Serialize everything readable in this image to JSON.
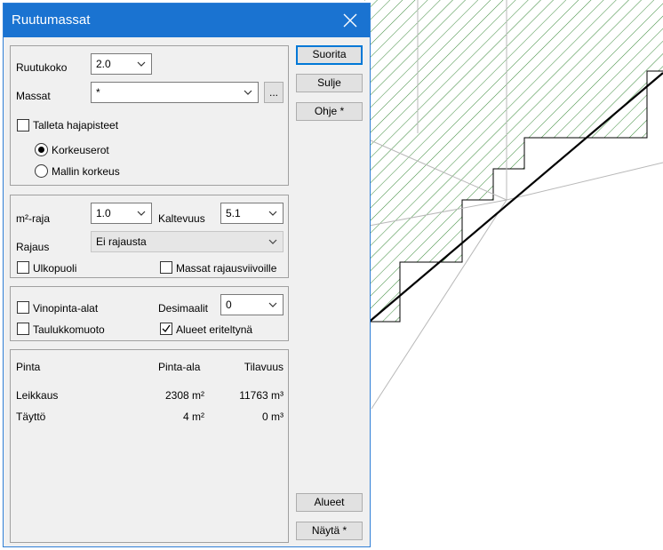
{
  "window": {
    "title": "Ruutumassat"
  },
  "settings": {
    "ruutukoko_label": "Ruutukoko",
    "ruutukoko_value": "2.0",
    "massat_label": "Massat",
    "massat_value": "*",
    "browse_label": "...",
    "talleta_label": "Talleta hajapisteet",
    "talleta_checked": false,
    "korkeuserot_label": "Korkeuserot",
    "korkeuserot_selected": true,
    "mallin_korkeus_label": "Mallin korkeus",
    "mallin_korkeus_selected": false
  },
  "limits": {
    "m2_raja_label": "m²-raja",
    "m2_raja_value": "1.0",
    "kaltevuus_label": "Kaltevuus",
    "kaltevuus_value": "5.1",
    "rajaus_label": "Rajaus",
    "rajaus_value": "Ei rajausta",
    "ulkopuoli_label": "Ulkopuoli",
    "ulkopuoli_checked": false,
    "massat_rajaus_label": "Massat rajausviivoille",
    "massat_rajaus_checked": false
  },
  "output": {
    "vinopinta_label": "Vinopinta-alat",
    "vinopinta_checked": false,
    "taulukko_label": "Taulukkomuoto",
    "taulukko_checked": false,
    "desimaalit_label": "Desimaalit",
    "desimaalit_value": "0",
    "alueet_eriteltyna_label": "Alueet eriteltynä",
    "alueet_eriteltyna_checked": true
  },
  "results": {
    "headers": {
      "pinta": "Pinta",
      "pinta_ala": "Pinta-ala",
      "tilavuus": "Tilavuus"
    },
    "rows": [
      {
        "pinta": "Leikkaus",
        "pinta_ala": "2308 m²",
        "tilavuus": "11763 m³"
      },
      {
        "pinta": "Täyttö",
        "pinta_ala": "4 m²",
        "tilavuus": "0 m³"
      }
    ]
  },
  "buttons": {
    "suorita": "Suorita",
    "sulje": "Sulje",
    "ohje": "Ohje *",
    "alueet": "Alueet",
    "nayta": "Näytä *"
  },
  "colors": {
    "titlebar": "#1a73d1",
    "hatch": "#3a8a3a",
    "dialog_bg": "#f0f0f0"
  }
}
